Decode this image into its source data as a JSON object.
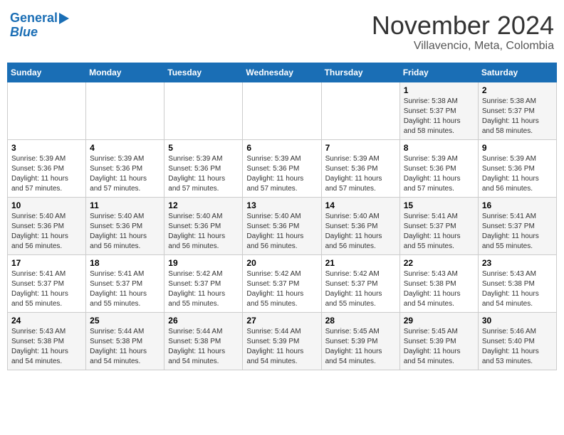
{
  "header": {
    "logo_line1": "General",
    "logo_line2": "Blue",
    "month": "November 2024",
    "location": "Villavencio, Meta, Colombia"
  },
  "days_of_week": [
    "Sunday",
    "Monday",
    "Tuesday",
    "Wednesday",
    "Thursday",
    "Friday",
    "Saturday"
  ],
  "rows": [
    [
      {
        "day": "",
        "info": ""
      },
      {
        "day": "",
        "info": ""
      },
      {
        "day": "",
        "info": ""
      },
      {
        "day": "",
        "info": ""
      },
      {
        "day": "",
        "info": ""
      },
      {
        "day": "1",
        "info": "Sunrise: 5:38 AM\nSunset: 5:37 PM\nDaylight: 11 hours\nand 58 minutes."
      },
      {
        "day": "2",
        "info": "Sunrise: 5:38 AM\nSunset: 5:37 PM\nDaylight: 11 hours\nand 58 minutes."
      }
    ],
    [
      {
        "day": "3",
        "info": "Sunrise: 5:39 AM\nSunset: 5:36 PM\nDaylight: 11 hours\nand 57 minutes."
      },
      {
        "day": "4",
        "info": "Sunrise: 5:39 AM\nSunset: 5:36 PM\nDaylight: 11 hours\nand 57 minutes."
      },
      {
        "day": "5",
        "info": "Sunrise: 5:39 AM\nSunset: 5:36 PM\nDaylight: 11 hours\nand 57 minutes."
      },
      {
        "day": "6",
        "info": "Sunrise: 5:39 AM\nSunset: 5:36 PM\nDaylight: 11 hours\nand 57 minutes."
      },
      {
        "day": "7",
        "info": "Sunrise: 5:39 AM\nSunset: 5:36 PM\nDaylight: 11 hours\nand 57 minutes."
      },
      {
        "day": "8",
        "info": "Sunrise: 5:39 AM\nSunset: 5:36 PM\nDaylight: 11 hours\nand 57 minutes."
      },
      {
        "day": "9",
        "info": "Sunrise: 5:39 AM\nSunset: 5:36 PM\nDaylight: 11 hours\nand 56 minutes."
      }
    ],
    [
      {
        "day": "10",
        "info": "Sunrise: 5:40 AM\nSunset: 5:36 PM\nDaylight: 11 hours\nand 56 minutes."
      },
      {
        "day": "11",
        "info": "Sunrise: 5:40 AM\nSunset: 5:36 PM\nDaylight: 11 hours\nand 56 minutes."
      },
      {
        "day": "12",
        "info": "Sunrise: 5:40 AM\nSunset: 5:36 PM\nDaylight: 11 hours\nand 56 minutes."
      },
      {
        "day": "13",
        "info": "Sunrise: 5:40 AM\nSunset: 5:36 PM\nDaylight: 11 hours\nand 56 minutes."
      },
      {
        "day": "14",
        "info": "Sunrise: 5:40 AM\nSunset: 5:36 PM\nDaylight: 11 hours\nand 56 minutes."
      },
      {
        "day": "15",
        "info": "Sunrise: 5:41 AM\nSunset: 5:37 PM\nDaylight: 11 hours\nand 55 minutes."
      },
      {
        "day": "16",
        "info": "Sunrise: 5:41 AM\nSunset: 5:37 PM\nDaylight: 11 hours\nand 55 minutes."
      }
    ],
    [
      {
        "day": "17",
        "info": "Sunrise: 5:41 AM\nSunset: 5:37 PM\nDaylight: 11 hours\nand 55 minutes."
      },
      {
        "day": "18",
        "info": "Sunrise: 5:41 AM\nSunset: 5:37 PM\nDaylight: 11 hours\nand 55 minutes."
      },
      {
        "day": "19",
        "info": "Sunrise: 5:42 AM\nSunset: 5:37 PM\nDaylight: 11 hours\nand 55 minutes."
      },
      {
        "day": "20",
        "info": "Sunrise: 5:42 AM\nSunset: 5:37 PM\nDaylight: 11 hours\nand 55 minutes."
      },
      {
        "day": "21",
        "info": "Sunrise: 5:42 AM\nSunset: 5:37 PM\nDaylight: 11 hours\nand 55 minutes."
      },
      {
        "day": "22",
        "info": "Sunrise: 5:43 AM\nSunset: 5:38 PM\nDaylight: 11 hours\nand 54 minutes."
      },
      {
        "day": "23",
        "info": "Sunrise: 5:43 AM\nSunset: 5:38 PM\nDaylight: 11 hours\nand 54 minutes."
      }
    ],
    [
      {
        "day": "24",
        "info": "Sunrise: 5:43 AM\nSunset: 5:38 PM\nDaylight: 11 hours\nand 54 minutes."
      },
      {
        "day": "25",
        "info": "Sunrise: 5:44 AM\nSunset: 5:38 PM\nDaylight: 11 hours\nand 54 minutes."
      },
      {
        "day": "26",
        "info": "Sunrise: 5:44 AM\nSunset: 5:38 PM\nDaylight: 11 hours\nand 54 minutes."
      },
      {
        "day": "27",
        "info": "Sunrise: 5:44 AM\nSunset: 5:39 PM\nDaylight: 11 hours\nand 54 minutes."
      },
      {
        "day": "28",
        "info": "Sunrise: 5:45 AM\nSunset: 5:39 PM\nDaylight: 11 hours\nand 54 minutes."
      },
      {
        "day": "29",
        "info": "Sunrise: 5:45 AM\nSunset: 5:39 PM\nDaylight: 11 hours\nand 54 minutes."
      },
      {
        "day": "30",
        "info": "Sunrise: 5:46 AM\nSunset: 5:40 PM\nDaylight: 11 hours\nand 53 minutes."
      }
    ]
  ]
}
